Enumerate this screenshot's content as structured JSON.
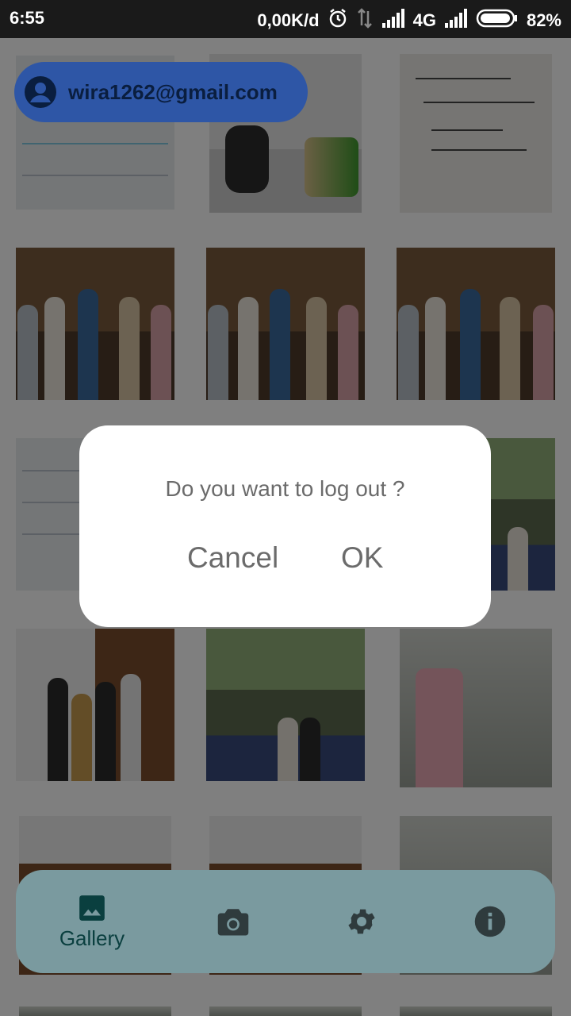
{
  "status_bar": {
    "time": "6:55",
    "net_speed": "0,00K/d",
    "network_type": "4G",
    "battery_percent": "82%",
    "icons": [
      "alarm-icon",
      "data-activity-icon",
      "signal-icon",
      "battery-icon"
    ]
  },
  "account": {
    "email": "wira1262@gmail.com",
    "icon": "account-circle-icon"
  },
  "dialog": {
    "message": "Do you want to log out ?",
    "cancel_label": "Cancel",
    "ok_label": "OK"
  },
  "bottom_nav": {
    "items": [
      {
        "icon": "image-icon",
        "label": "Gallery",
        "active": true
      },
      {
        "icon": "camera-icon",
        "label": ""
      },
      {
        "icon": "gear-icon",
        "label": ""
      },
      {
        "icon": "info-icon",
        "label": ""
      }
    ]
  },
  "colors": {
    "nav_active": "#0a3f3f",
    "nav_bg": "#7a9a9f",
    "account_chip_bg": "#2e56a6",
    "dialog_text": "#6b6b6b"
  }
}
